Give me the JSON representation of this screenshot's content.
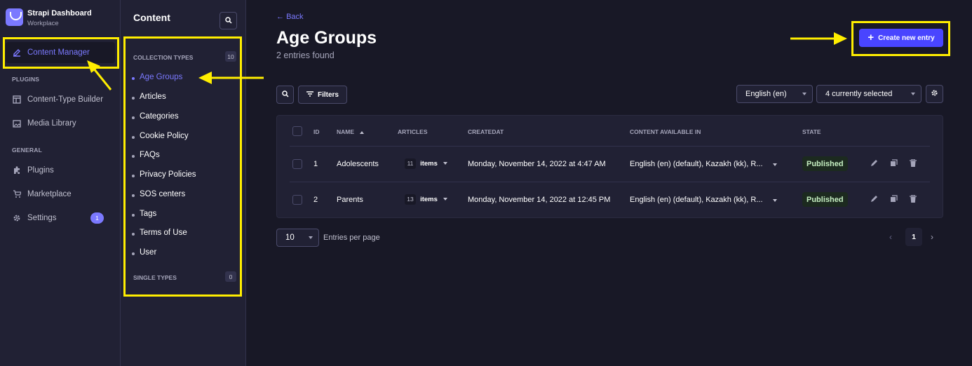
{
  "brand": {
    "name": "Strapi Dashboard",
    "workspace": "Workplace"
  },
  "mainnav": {
    "content_manager": "Content Manager",
    "plugins_heading": "PLUGINS",
    "content_type_builder": "Content-Type Builder",
    "media_library": "Media Library",
    "general_heading": "GENERAL",
    "plugins": "Plugins",
    "marketplace": "Marketplace",
    "settings": "Settings",
    "settings_badge": "1"
  },
  "subnav": {
    "title": "Content",
    "collection_heading": "COLLECTION TYPES",
    "collection_count": "10",
    "items": [
      "Age Groups",
      "Articles",
      "Categories",
      "Cookie Policy",
      "FAQs",
      "Privacy Policies",
      "SOS centers",
      "Tags",
      "Terms of Use",
      "User"
    ],
    "single_heading": "SINGLE TYPES",
    "single_count": "0"
  },
  "header": {
    "back": "Back",
    "title": "Age Groups",
    "subtitle": "2 entries found",
    "create_button": "Create new entry"
  },
  "toolbar": {
    "filters": "Filters",
    "locale": "English (en)",
    "columns": "4 currently selected"
  },
  "table": {
    "headers": [
      "ID",
      "NAME",
      "ARTICLES",
      "CREATEDAT",
      "CONTENT AVAILABLE IN",
      "STATE"
    ],
    "rows": [
      {
        "id": "1",
        "name": "Adolescents",
        "articles_count": "11",
        "articles_label": "items",
        "created": "Monday, November 14, 2022 at 4:47 AM",
        "locales": "English (en) (default), Kazakh (kk), R...",
        "state": "Published"
      },
      {
        "id": "2",
        "name": "Parents",
        "articles_count": "13",
        "articles_label": "items",
        "created": "Monday, November 14, 2022 at 12:45 PM",
        "locales": "English (en) (default), Kazakh (kk), R...",
        "state": "Published"
      }
    ]
  },
  "pagination": {
    "page_size": "10",
    "page_size_label": "Entries per page",
    "current_page": "1"
  },
  "colors": {
    "accent": "#7b79ff",
    "primary": "#4945ff",
    "annotation": "#ffee00",
    "published": "#c6f0c2"
  }
}
